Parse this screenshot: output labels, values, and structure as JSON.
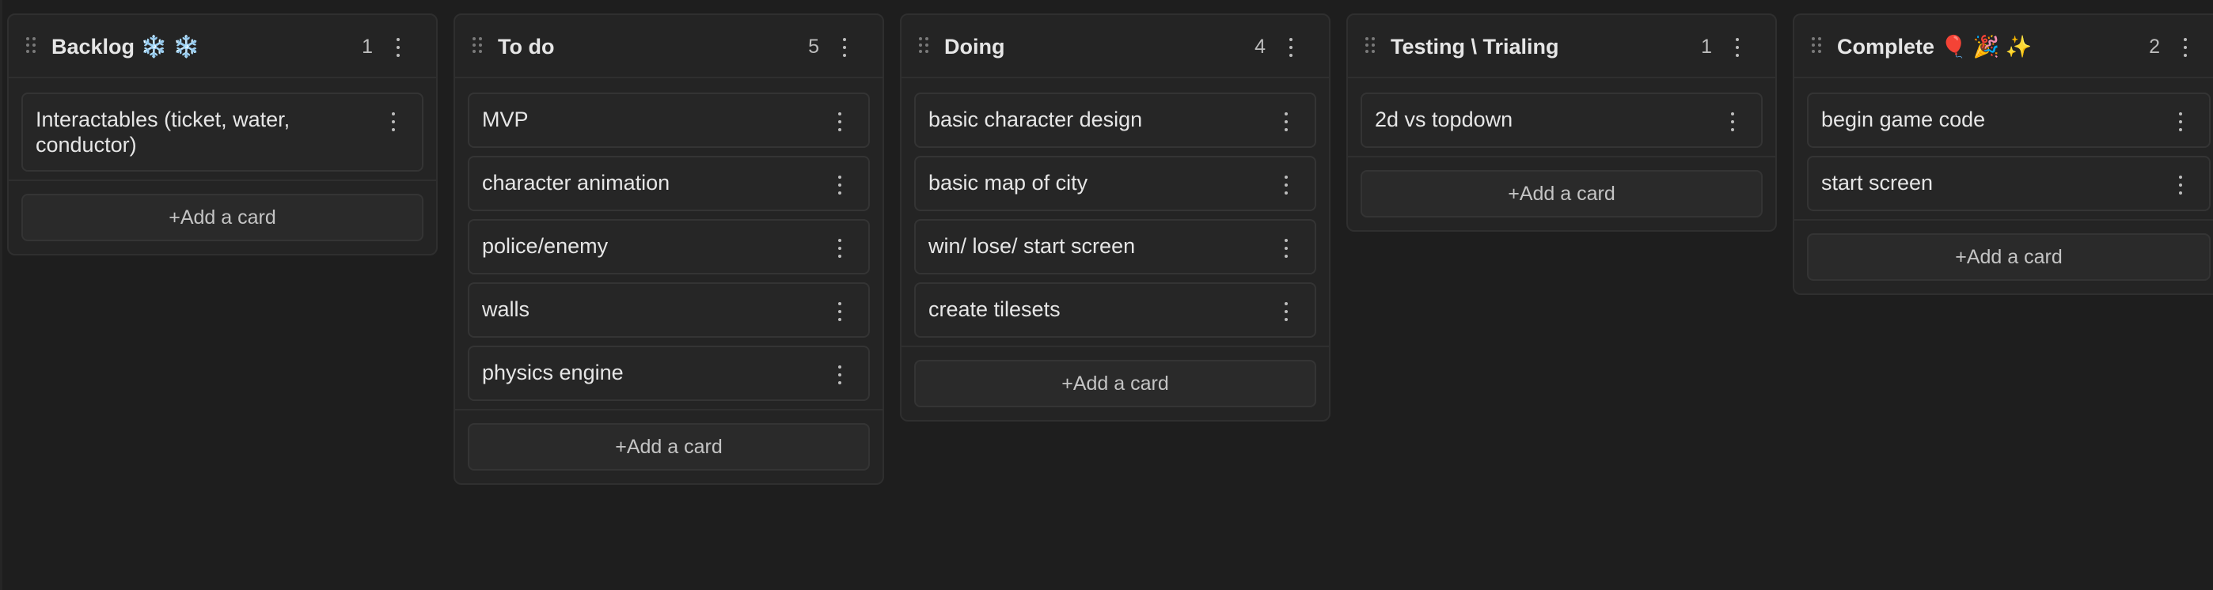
{
  "columns": [
    {
      "title": "Backlog ❄️ ❄️",
      "count": "1",
      "cards": [
        "Interactables (ticket, water, conductor)"
      ],
      "add_label": "+Add a card"
    },
    {
      "title": "To do",
      "count": "5",
      "cards": [
        "MVP",
        "character animation",
        "police/enemy",
        "walls",
        "physics engine"
      ],
      "add_label": "+Add a card"
    },
    {
      "title": "Doing",
      "count": "4",
      "cards": [
        "basic character design",
        "basic map of city",
        "win/ lose/ start screen",
        "create tilesets"
      ],
      "add_label": "+Add a card"
    },
    {
      "title": "Testing \\ Trialing",
      "count": "1",
      "cards": [
        "2d vs topdown"
      ],
      "add_label": "+Add a card"
    },
    {
      "title": "Complete 🎈 🎉 ✨",
      "count": "2",
      "cards": [
        "begin game code",
        "start screen"
      ],
      "add_label": "+Add a card"
    }
  ],
  "icons": {
    "drag_handle": "drag-handle-icon",
    "more": "more-vertical-icon"
  }
}
